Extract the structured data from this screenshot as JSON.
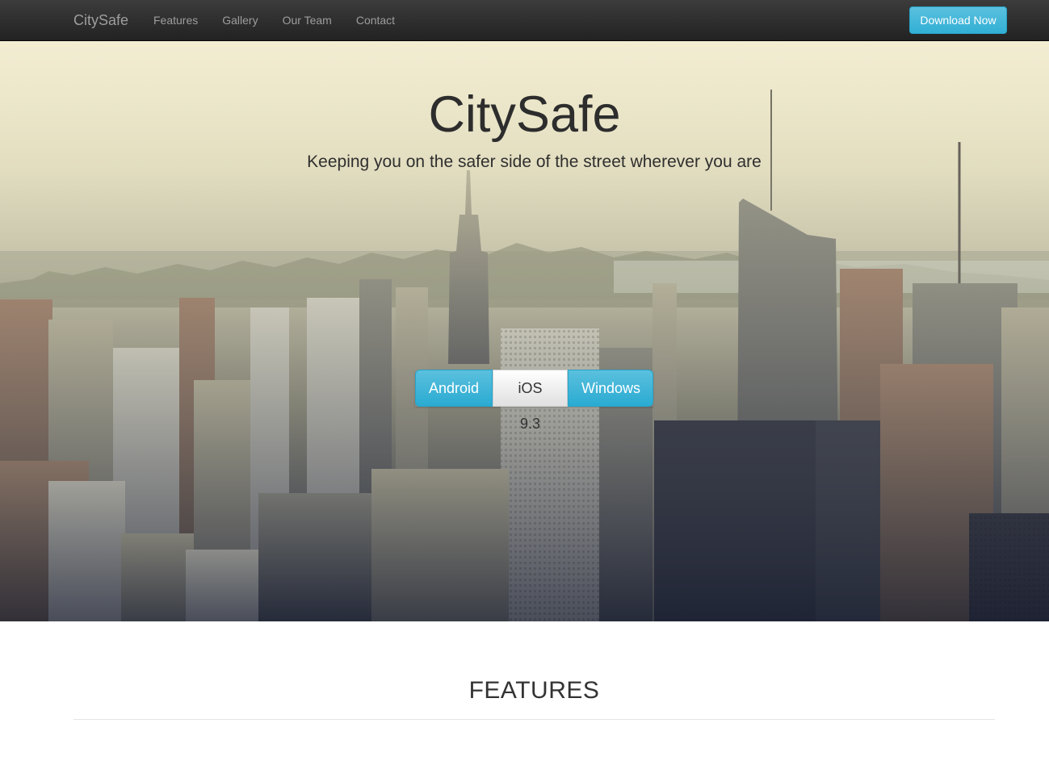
{
  "navbar": {
    "brand": "CitySafe",
    "links": [
      {
        "label": "Features"
      },
      {
        "label": "Gallery"
      },
      {
        "label": "Our Team"
      },
      {
        "label": "Contact"
      }
    ],
    "download_label": "Download Now"
  },
  "hero": {
    "title": "CitySafe",
    "subtitle": "Keeping you on the safer side of the street wherever you are",
    "platforms": [
      {
        "label": "Android",
        "style": "info"
      },
      {
        "label": "iOS 9.3",
        "style": "default"
      },
      {
        "label": "Windows",
        "style": "info"
      }
    ]
  },
  "features": {
    "heading": "FEATURES"
  },
  "colors": {
    "navbar_bg": "#222222",
    "accent_info": "#5bc0de",
    "nav_text": "#9d9d9d"
  }
}
